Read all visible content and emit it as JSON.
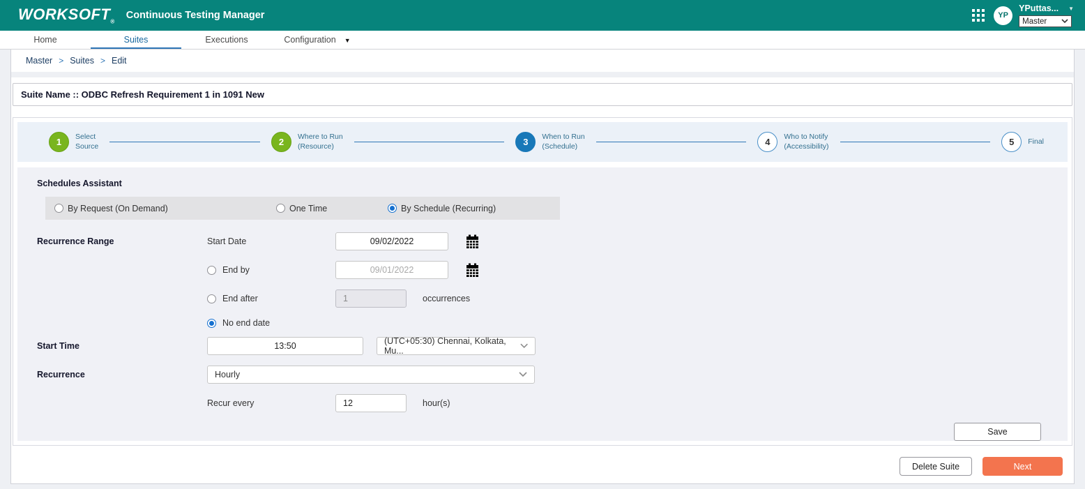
{
  "header": {
    "brand": "WORKSOFT",
    "brand_reg": "®",
    "app_title": "Continuous Testing Manager",
    "avatar_initials": "YP",
    "username": "YPuttas...",
    "tenant": "Master"
  },
  "nav": {
    "tabs": [
      {
        "label": "Home",
        "active": false
      },
      {
        "label": "Suites",
        "active": true
      },
      {
        "label": "Executions",
        "active": false
      },
      {
        "label": "Configuration",
        "active": false
      }
    ]
  },
  "breadcrumb": {
    "items": [
      "Master",
      "Suites",
      "Edit"
    ],
    "separator": ">"
  },
  "suite": {
    "title": "Suite Name :: ODBC Refresh Requirement 1 in 1091 New"
  },
  "wizard": {
    "steps": [
      {
        "num": "1",
        "line1": "Select",
        "line2": "Source",
        "state": "done"
      },
      {
        "num": "2",
        "line1": "Where to Run",
        "line2": "(Resource)",
        "state": "done"
      },
      {
        "num": "3",
        "line1": "When to Run",
        "line2": "(Schedule)",
        "state": "current"
      },
      {
        "num": "4",
        "line1": "Who to Notify",
        "line2": "(Accessibility)",
        "state": "todo"
      },
      {
        "num": "5",
        "line1": "Final",
        "line2": "",
        "state": "todo"
      }
    ]
  },
  "form": {
    "section_title": "Schedules Assistant",
    "modes": [
      {
        "label": "By Request (On Demand)",
        "selected": false
      },
      {
        "label": "One Time",
        "selected": false
      },
      {
        "label": "By Schedule (Recurring)",
        "selected": true
      }
    ],
    "range": {
      "label": "Recurrence Range",
      "start_date_label": "Start Date",
      "start_date_value": "09/02/2022",
      "end_by_label": "End by",
      "end_by_value": "09/01/2022",
      "end_after_label": "End after",
      "end_after_value": "1",
      "occurrences_label": "occurrences",
      "no_end_label": "No end date"
    },
    "time": {
      "label": "Start Time",
      "value": "13:50",
      "timezone": "(UTC+05:30) Chennai, Kolkata, Mu..."
    },
    "recurrence": {
      "label": "Recurrence",
      "value": "Hourly",
      "every_label": "Recur every",
      "every_value": "12",
      "unit": "hour(s)"
    },
    "save_label": "Save"
  },
  "actions": {
    "delete_label": "Delete Suite",
    "next_label": "Next"
  },
  "icons": {
    "caret_down": "▼"
  },
  "colors": {
    "brand_teal": "#07847c",
    "active_tab_blue": "#2e75b6",
    "step_done_green": "#79b51e",
    "step_current_blue": "#1878b8",
    "next_orange": "#f3744e",
    "stepper_bg": "#ebf1f8",
    "form_bg": "#f0f1f6"
  }
}
